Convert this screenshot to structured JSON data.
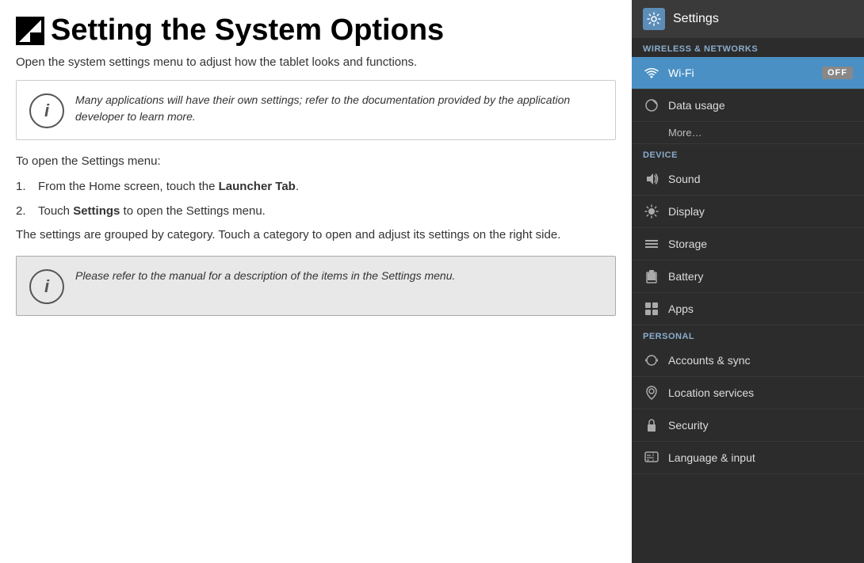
{
  "page": {
    "title": "Setting the System Options",
    "subtitle": "Open the system settings menu to adjust how the tablet looks and functions.",
    "info_box_1": {
      "text": "Many applications will have their own settings; refer to the documentation provided by the application developer to learn more."
    },
    "body_1": "To open the Settings menu:",
    "steps": [
      {
        "num": "1.",
        "text_before": "From the Home screen, touch the ",
        "bold": "Launcher Tab",
        "text_after": "."
      },
      {
        "num": "2.",
        "text_before": "Touch ",
        "bold": "Settings",
        "text_after": " to open the Settings menu."
      }
    ],
    "body_2": "The settings are grouped by category. Touch a category to open and adjust its settings on the right side.",
    "info_box_2": {
      "text": "Please refer to the manual for a description of the items in the Settings menu."
    }
  },
  "settings_panel": {
    "header": {
      "title": "Settings",
      "icon": "settings-icon"
    },
    "sections": [
      {
        "label": "WIRELESS & NETWORKS",
        "items": [
          {
            "id": "wifi",
            "label": "Wi-Fi",
            "toggle": "OFF",
            "active": true
          },
          {
            "id": "data-usage",
            "label": "Data usage",
            "active": false
          },
          {
            "id": "more",
            "label": "More…",
            "indent": true,
            "active": false
          }
        ]
      },
      {
        "label": "DEVICE",
        "items": [
          {
            "id": "sound",
            "label": "Sound",
            "active": false
          },
          {
            "id": "display",
            "label": "Display",
            "active": false
          },
          {
            "id": "storage",
            "label": "Storage",
            "active": false
          },
          {
            "id": "battery",
            "label": "Battery",
            "active": false
          },
          {
            "id": "apps",
            "label": "Apps",
            "active": false
          }
        ]
      },
      {
        "label": "PERSONAL",
        "items": [
          {
            "id": "accounts-sync",
            "label": "Accounts & sync",
            "active": false
          },
          {
            "id": "location-services",
            "label": "Location services",
            "active": false
          },
          {
            "id": "security",
            "label": "Security",
            "active": false
          },
          {
            "id": "language-input",
            "label": "Language & input",
            "active": false
          }
        ]
      }
    ],
    "off_label": "OFF"
  }
}
